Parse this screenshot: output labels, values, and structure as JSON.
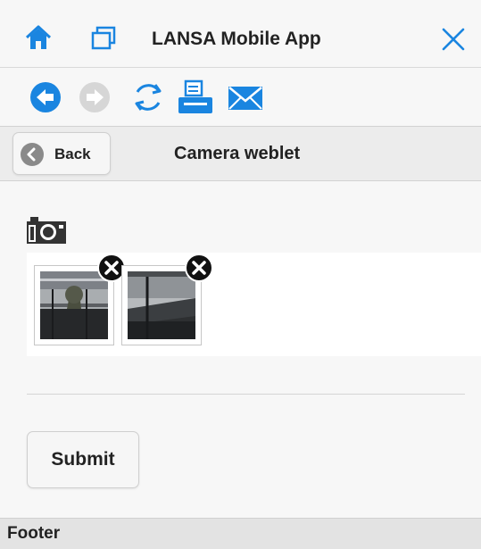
{
  "app": {
    "title": "LANSA Mobile App",
    "accent_color": "#1a85e0"
  },
  "titlebar_icons": [
    "home-icon",
    "windows-icon",
    "close-icon"
  ],
  "toolbar": {
    "icons": [
      "back-arrow-icon",
      "forward-arrow-disabled-icon",
      "refresh-icon",
      "print-icon",
      "email-icon"
    ]
  },
  "header": {
    "back_label": "Back",
    "page_title": "Camera weblet"
  },
  "photos": {
    "count": 2,
    "icon": "camera-icon",
    "delete_icon": "remove-photo-icon"
  },
  "form": {
    "submit_label": "Submit"
  },
  "footer": {
    "label": "Footer"
  }
}
